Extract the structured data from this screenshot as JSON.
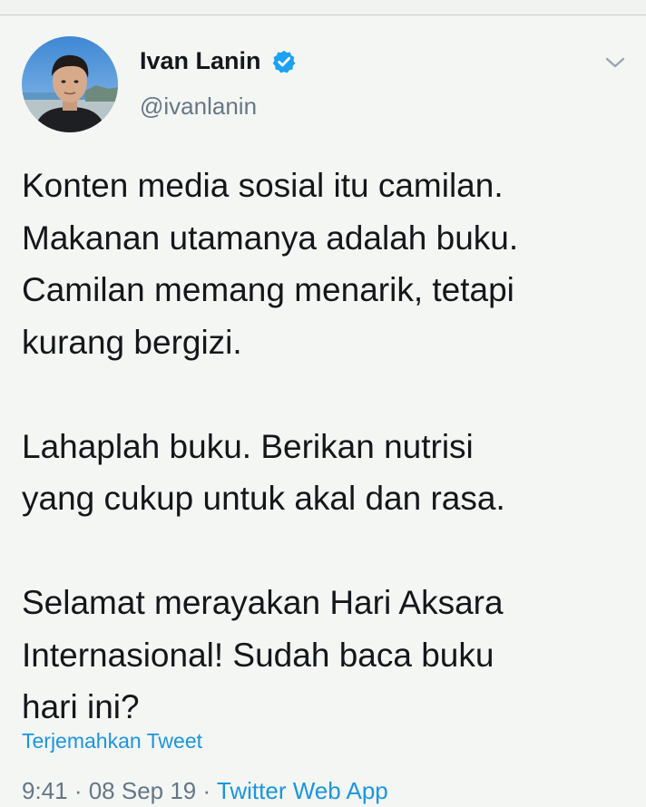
{
  "tweet": {
    "author_name": "Ivan Lanin",
    "handle": "@ivanlanin",
    "text": "Konten media sosial itu camilan.\nMakanan utamanya adalah buku.\nCamilan memang menarik, tetapi\nkurang bergizi.\n\nLahaplah buku. Berikan nutrisi\nyang cukup untuk akal dan rasa.\n\nSelamat merayakan Hari Aksara\nInternasional! Sudah baca buku\nhari ini?",
    "translate_label": "Terjemahkan Tweet",
    "time": "9:41",
    "separator": " · ",
    "date": "08 Sep 19",
    "source": "Twitter Web App"
  },
  "icons": {
    "verified": "verified-badge-icon",
    "more": "chevron-down-icon"
  },
  "colors": {
    "background": "#f4f6f4",
    "text": "#14171a",
    "secondary": "#657786",
    "link": "#1b95e0",
    "verified": "#1da1f2"
  }
}
